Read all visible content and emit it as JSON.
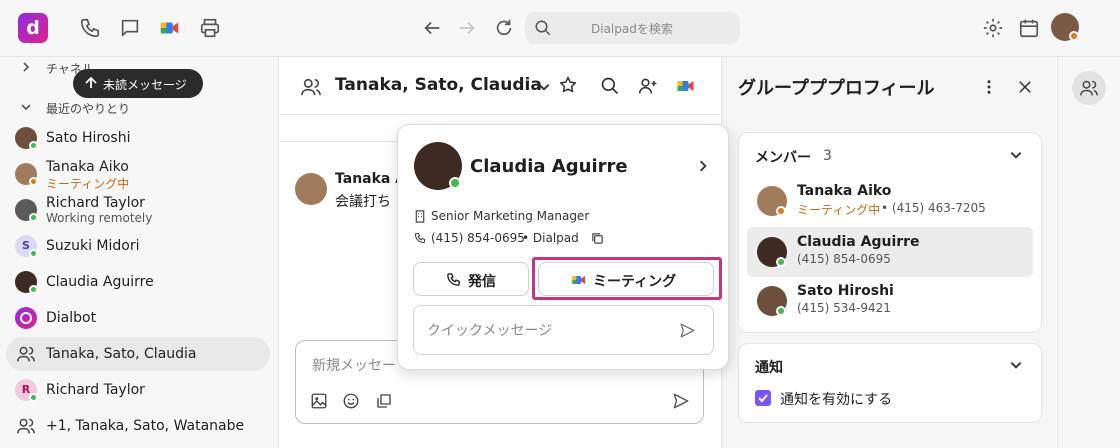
{
  "topbar": {
    "logo_letter": "d",
    "search_placeholder": "Dialpadを検索"
  },
  "sidebar": {
    "channels_label": "チャネル",
    "recent_label": "最近のやりとり",
    "unread_tooltip": "未読メッセージ",
    "items": [
      {
        "name": "Sato Hiroshi",
        "sub": "",
        "status": "green"
      },
      {
        "name": "Tanaka Aiko",
        "sub": "ミーティング中",
        "status": "orange"
      },
      {
        "name": "Richard Taylor",
        "sub": "Working remotely",
        "status": "green"
      },
      {
        "name": "Suzuki Midori",
        "sub": "",
        "status": "green",
        "initial": "S"
      },
      {
        "name": "Claudia Aguirre",
        "sub": "",
        "status": "green"
      },
      {
        "name": "Dialbot",
        "sub": ""
      },
      {
        "name": "Tanaka, Sato, Claudia",
        "sub": ""
      },
      {
        "name": "Richard Taylor",
        "sub": "",
        "status": "green",
        "initial": "R"
      },
      {
        "name": "+1, Tanaka, Sato, Watanabe",
        "sub": ""
      }
    ]
  },
  "chat": {
    "title": "Tanaka, Sato, Claudia",
    "message_sender": "Tanaka A",
    "message_text": "会議打ち",
    "compose_placeholder": "新規メッセー"
  },
  "popup": {
    "name": "Claudia Aguirre",
    "job_title": "Senior Marketing Manager",
    "phone": "(415) 854-0695",
    "phone_suffix": "• Dialpad",
    "call_label": "発信",
    "meeting_label": "ミーティング",
    "quick_message_placeholder": "クイックメッセージ"
  },
  "profile": {
    "title": "グループププロフィール",
    "members_label": "メンバー",
    "members_count": "3",
    "members": [
      {
        "name": "Tanaka Aiko",
        "status_text": "ミーティング中",
        "phone": "• (415) 463-7205",
        "status": "orange"
      },
      {
        "name": "Claudia Aguirre",
        "status_text": "",
        "phone": "(415) 854-0695",
        "status": "green"
      },
      {
        "name": "Sato Hiroshi",
        "status_text": "",
        "phone": "(415) 534-9421",
        "status": "green"
      }
    ],
    "notifications_label": "通知",
    "notifications_checkbox_label": "通知を有効にする"
  },
  "colors": {
    "accent": "#7c52ff",
    "highlight": "#c2387a",
    "meeting_orange": "#c46a12"
  }
}
